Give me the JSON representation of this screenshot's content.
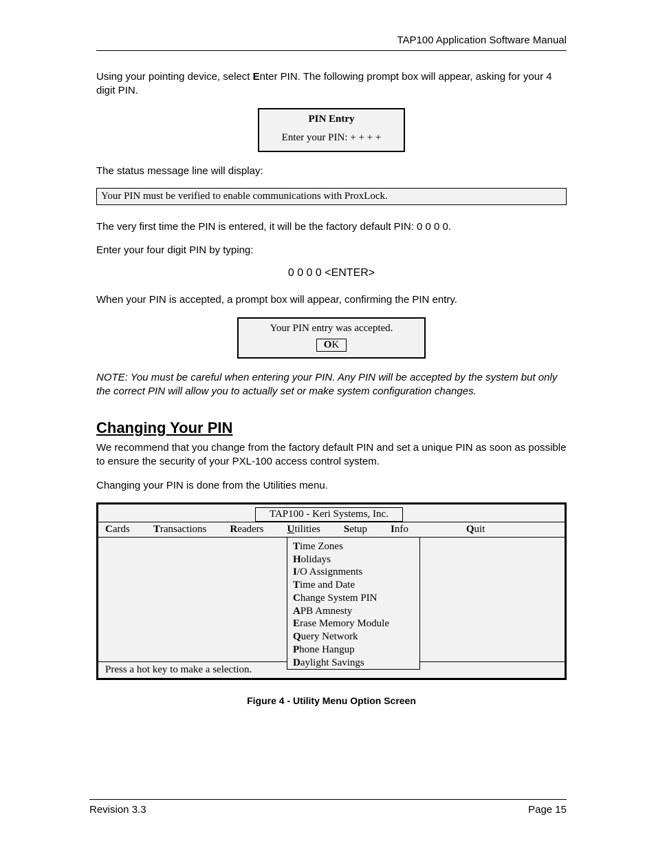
{
  "header": {
    "doc_title": "TAP100 Application Software Manual"
  },
  "paragraphs": {
    "intro_before_bold": "Using your pointing device, select ",
    "intro_bold": "E",
    "intro_after_bold": "nter PIN. The following prompt box will appear, asking for your 4 digit PIN.",
    "status_line_intro": "The status message line will display:",
    "after_status": "The very first time the PIN is entered, it will be the factory default PIN:  0  0  0  0.",
    "enter_four": "Enter your four digit PIN by typing:",
    "keystroke": "0 0 0 0  <ENTER>",
    "pin_accepted_intro": "When your PIN is accepted, a prompt box will appear, confirming the PIN entry.",
    "note": "NOTE: You must be careful when entering your PIN. Any PIN will be accepted by the system but only the correct PIN will allow you to actually set or make system configuration changes.",
    "changing_heading": "Changing Your PIN",
    "changing_body": "We recommend that you change from the factory default PIN and set a unique PIN as soon as possible to ensure the security of your PXL-100 access control system.",
    "changing_body2": "Changing your PIN is done from the Utilities menu."
  },
  "pin_entry_box": {
    "title": "PIN Entry",
    "prompt": "Enter your PIN:   + + + +"
  },
  "status_bar": {
    "text": "Your PIN must be verified to enable communications with ProxLock."
  },
  "accepted_box": {
    "message": "Your PIN entry was accepted.",
    "ok_bold": "O",
    "ok_rest": "K"
  },
  "util_window": {
    "title": "TAP100 - Keri Systems, Inc.",
    "menu": {
      "cards": {
        "hot": "C",
        "rest": "ards"
      },
      "transactions": {
        "hot": "T",
        "rest": "ransactions"
      },
      "readers": {
        "hot": "R",
        "rest": "eaders"
      },
      "utilities": {
        "hot": "U",
        "rest": "tilities"
      },
      "setup": {
        "hot": "S",
        "rest": "etup"
      },
      "info": {
        "hot": "I",
        "rest": "nfo"
      },
      "quit": {
        "hot": "Q",
        "rest": "uit"
      }
    },
    "dropdown": [
      {
        "hot": "T",
        "rest": "ime Zones"
      },
      {
        "hot": "H",
        "rest": "olidays"
      },
      {
        "hot": "I",
        "rest": "/O  Assignments"
      },
      {
        "hot": "T",
        "rest": "ime and Date"
      },
      {
        "hot": "C",
        "rest": "hange System PIN"
      },
      {
        "hot": "A",
        "rest": "PB Amnesty"
      },
      {
        "hot": "E",
        "rest": "rase Memory Module"
      },
      {
        "hot": "Q",
        "rest": "uery Network"
      },
      {
        "hot": "P",
        "rest": "hone Hangup"
      },
      {
        "hot": "D",
        "rest": "aylight Savings"
      }
    ],
    "status": "Press a hot key to make a selection."
  },
  "figure_caption": "Figure 4 - Utility Menu Option Screen",
  "footer": {
    "revision": "Revision 3.3",
    "page": "Page 15"
  }
}
